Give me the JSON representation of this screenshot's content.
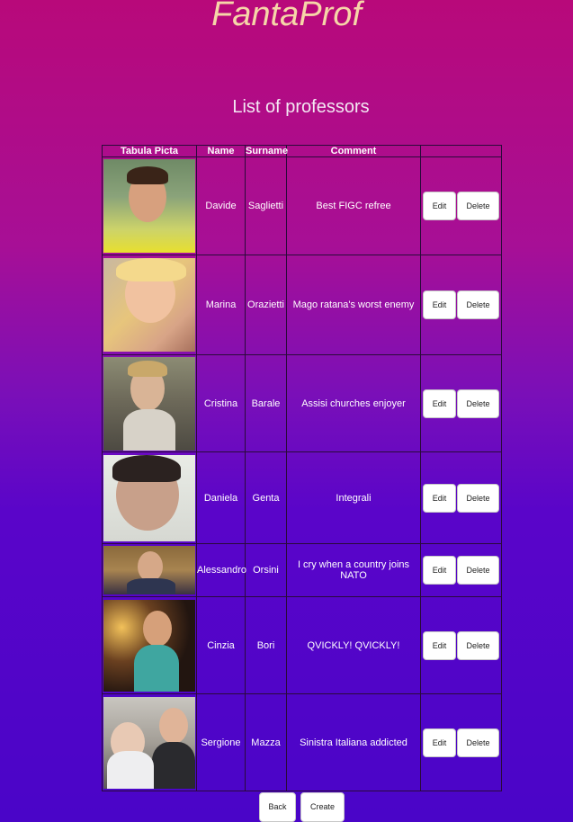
{
  "app": {
    "title": "FantaProf"
  },
  "page": {
    "heading": "List of professors"
  },
  "table": {
    "headers": [
      "Tabula Picta",
      "Name",
      "Surname",
      "Comment",
      ""
    ],
    "rows": [
      {
        "name": "Davide",
        "surname": "Saglietti",
        "comment": "Best FIGC refree",
        "edit": "Edit",
        "delete": "Delete"
      },
      {
        "name": "Marina",
        "surname": "Orazietti",
        "comment": "Mago ratana's worst enemy",
        "edit": "Edit",
        "delete": "Delete"
      },
      {
        "name": "Cristina",
        "surname": "Barale",
        "comment": "Assisi churches enjoyer",
        "edit": "Edit",
        "delete": "Delete"
      },
      {
        "name": "Daniela",
        "surname": "Genta",
        "comment": "Integrali",
        "edit": "Edit",
        "delete": "Delete"
      },
      {
        "name": "Alessandro",
        "surname": "Orsini",
        "comment": "I cry when a country joins NATO",
        "edit": "Edit",
        "delete": "Delete"
      },
      {
        "name": "Cinzia",
        "surname": "Bori",
        "comment": "QVICKLY! QVICKLY!",
        "edit": "Edit",
        "delete": "Delete"
      },
      {
        "name": "Sergione",
        "surname": "Mazza",
        "comment": "Sinistra Italiana addicted",
        "edit": "Edit",
        "delete": "Delete"
      }
    ]
  },
  "footer": {
    "back_label": "Back",
    "create_label": "Create"
  }
}
